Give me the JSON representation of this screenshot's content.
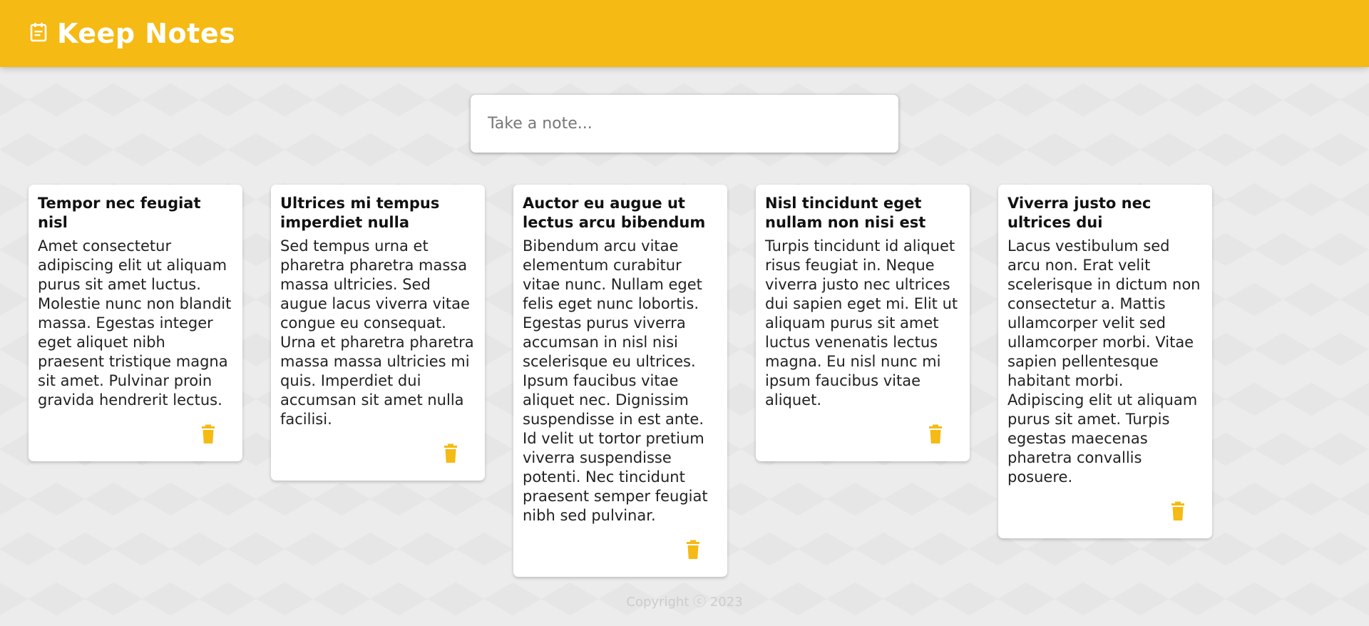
{
  "header": {
    "title": "Keep Notes",
    "icon": "note-icon"
  },
  "create_note": {
    "placeholder": "Take a note..."
  },
  "notes": [
    {
      "title": "Tempor nec feugiat nisl",
      "content": "Amet consectetur adipiscing elit ut aliquam purus sit amet luctus. Molestie nunc non blandit massa. Egestas integer eget aliquet nibh praesent tristique magna sit amet. Pulvinar proin gravida hendrerit lectus."
    },
    {
      "title": "Ultrices mi tempus imperdiet nulla",
      "content": "Sed tempus urna et pharetra pharetra massa massa ultricies. Sed augue lacus viverra vitae congue eu consequat. Urna et pharetra pharetra massa massa ultricies mi quis. Imperdiet dui accumsan sit amet nulla facilisi."
    },
    {
      "title": "Auctor eu augue ut lectus arcu bibendum",
      "content": "Bibendum arcu vitae elementum curabitur vitae nunc. Nullam eget felis eget nunc lobortis. Egestas purus viverra accumsan in nisl nisi scelerisque eu ultrices. Ipsum faucibus vitae aliquet nec. Dignissim suspendisse in est ante. Id velit ut tortor pretium viverra suspendisse potenti. Nec tincidunt praesent semper feugiat nibh sed pulvinar."
    },
    {
      "title": "Nisl tincidunt eget nullam non nisi est",
      "content": "Turpis tincidunt id aliquet risus feugiat in. Neque viverra justo nec ultrices dui sapien eget mi. Elit ut aliquam purus sit amet luctus venenatis lectus magna. Eu nisl nunc mi ipsum faucibus vitae aliquet."
    },
    {
      "title": "Viverra justo nec ultrices dui",
      "content": "Lacus vestibulum sed arcu non. Erat velit scelerisque in dictum non consectetur a. Mattis ullamcorper velit sed ullamcorper morbi. Vitae sapien pellentesque habitant morbi. Adipiscing elit ut aliquam purus sit amet. Turpis egestas maecenas pharetra convallis posuere."
    }
  ],
  "footer": {
    "text": "Copyright ⓒ 2023"
  },
  "colors": {
    "accent": "#f5ba13",
    "background": "#ececec",
    "card": "#ffffff"
  }
}
